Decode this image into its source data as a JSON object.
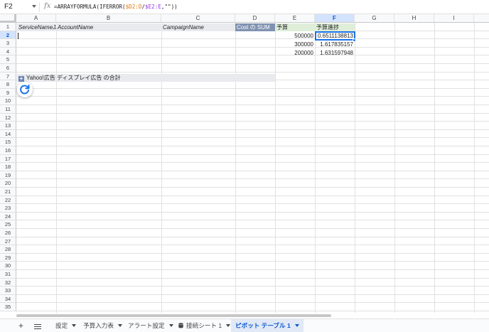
{
  "formula_bar": {
    "cell_ref": "F2",
    "fx": "fx",
    "formula_prefix": "=ARRAYFORMULA(IFERROR(",
    "formula_ref1": "$D2:D",
    "formula_slash": "/",
    "formula_ref2": "$E2:E",
    "formula_suffix": ",\"\"))"
  },
  "columns": [
    "A",
    "B",
    "C",
    "D",
    "E",
    "F",
    "G",
    "H",
    "I"
  ],
  "selected_column": "F",
  "rows": [
    "1",
    "2",
    "3",
    "4",
    "5",
    "6",
    "7",
    "8",
    "9",
    "10",
    "11",
    "12",
    "13",
    "14",
    "15",
    "16",
    "17",
    "18",
    "19",
    "20",
    "21",
    "22",
    "23",
    "24",
    "25",
    "26",
    "27",
    "28",
    "29",
    "30",
    "31",
    "32",
    "33",
    "34",
    "35"
  ],
  "selected_row": "2",
  "header_row": {
    "service": "ServiceNameJA",
    "account": "AccountName",
    "campaign": "CampaignName",
    "cost": "Cost の SUM",
    "budget": "予算",
    "progress": "予算進捗"
  },
  "budget_values": [
    "500000",
    "300000",
    "200000"
  ],
  "progress_values": [
    "0.6511138813",
    "1.617835157",
    "1.631597948"
  ],
  "pivot_total": {
    "icon": "+",
    "label": "Yahoo!広告 ディスプレイ広告 の合計"
  },
  "tabs": {
    "add_icon": "+",
    "items": [
      {
        "label": "設定"
      },
      {
        "label": "予算入力表"
      },
      {
        "label": "アラート設定"
      },
      {
        "label": "接続シート 1"
      },
      {
        "label": "ピボット テーブル 1"
      }
    ],
    "active_index": 4
  },
  "colors": {
    "selection": "#1a73e8",
    "cost_header": "#8092b0",
    "budget_header": "#dfeed9",
    "header_gray": "#e8eaed"
  }
}
